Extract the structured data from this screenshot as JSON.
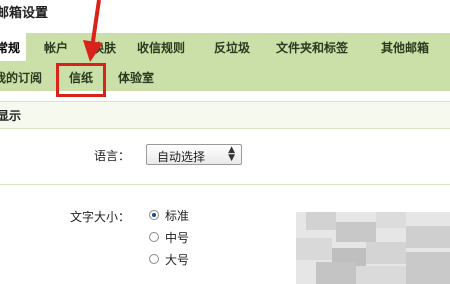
{
  "window": {
    "title": "邮箱设置"
  },
  "tabs_row1": [
    "常规",
    "帐户",
    "换肤",
    "收信规则",
    "反垃圾",
    "文件夹和标签",
    "其他邮箱"
  ],
  "tabs_row2": [
    "我的订阅",
    "信纸",
    "体验室"
  ],
  "section": {
    "title": "显示"
  },
  "language": {
    "label": "语言：",
    "value": "自动选择"
  },
  "font_size": {
    "label": "文字大小：",
    "options": [
      "标准",
      "中号",
      "大号"
    ],
    "selected": "标准"
  },
  "annotation": {
    "highlight_color": "#d9231a",
    "highlighted_tab": "信纸"
  }
}
